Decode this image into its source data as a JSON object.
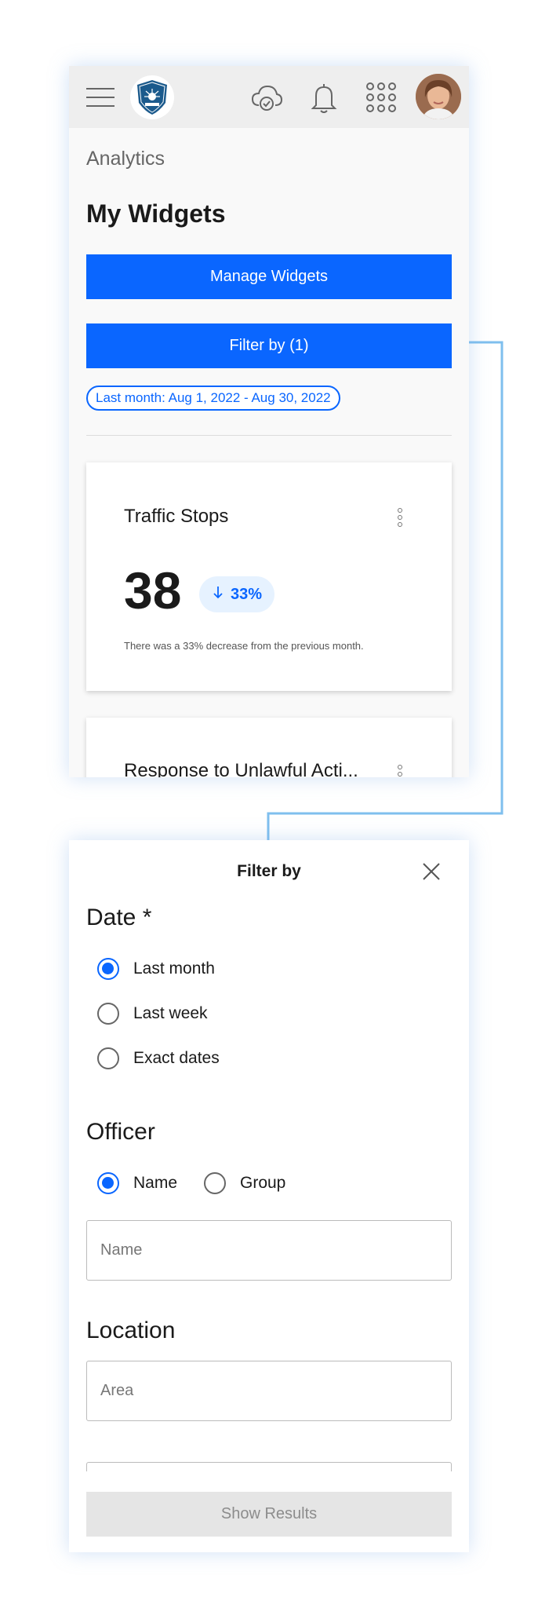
{
  "header": {
    "logo_icon": "liberty-police-badge-icon",
    "icons": [
      "cloud-check-icon",
      "bell-icon",
      "apps-grid-icon"
    ]
  },
  "analytics": {
    "breadcrumb": "Analytics",
    "title": "My Widgets",
    "manage_button": "Manage Widgets",
    "filter_button": "Filter by (1)",
    "date_chip": "Last month: Aug 1, 2022 - Aug 30, 2022"
  },
  "widgets": [
    {
      "title": "Traffic Stops",
      "value": "38",
      "trend": "33%",
      "trend_direction": "down",
      "description": "There was a 33% decrease from the previous month."
    },
    {
      "title": "Response to Unlawful Acti..."
    }
  ],
  "filter": {
    "title": "Filter by",
    "date": {
      "label": "Date *",
      "options": [
        "Last month",
        "Last week",
        "Exact dates"
      ],
      "selected": "Last month"
    },
    "officer": {
      "label": "Officer",
      "options": [
        "Name",
        "Group"
      ],
      "selected": "Name",
      "name_placeholder": "Name"
    },
    "location": {
      "label": "Location",
      "area_placeholder": "Area"
    },
    "show_results": "Show Results"
  },
  "colors": {
    "primary": "#0a66ff",
    "connector": "#7fbfee",
    "disabled_bg": "#e5e5e5"
  }
}
